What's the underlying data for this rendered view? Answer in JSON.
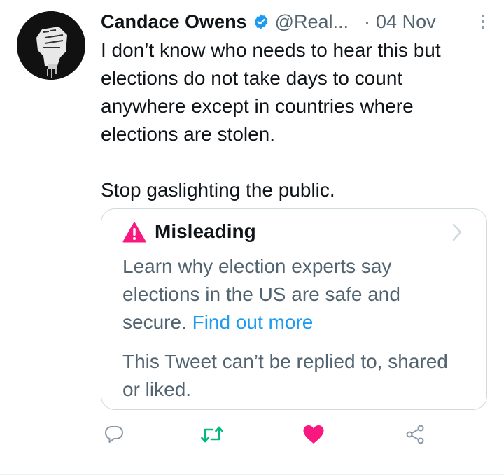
{
  "tweet": {
    "author_name": "Candace Owens",
    "handle": "@Real...",
    "separator": "·",
    "date": "04 Nov",
    "text": "I don’t know who needs to hear this but elections do not take days to count anywhere except in countries where elections are stolen.\n\nStop gaslighting the public."
  },
  "notice": {
    "title": "Misleading",
    "description": "Learn why election experts say elections in the US are safe and secure. ",
    "link_text": "Find out more",
    "restriction": "This Tweet can’t be replied to, shared or liked."
  },
  "icons": {
    "verified": "verified-badge-icon",
    "more": "more-options-icon",
    "warning": "warning-triangle-icon",
    "chevron": "chevron-right-icon",
    "reply": "reply-icon",
    "retweet": "retweet-icon",
    "like": "like-heart-icon",
    "share": "share-icon"
  },
  "colors": {
    "verified": "#1d9bf0",
    "warning": "#f91880",
    "link": "#1d9bf0",
    "retweet": "#00ba7c",
    "like": "#f91880"
  }
}
